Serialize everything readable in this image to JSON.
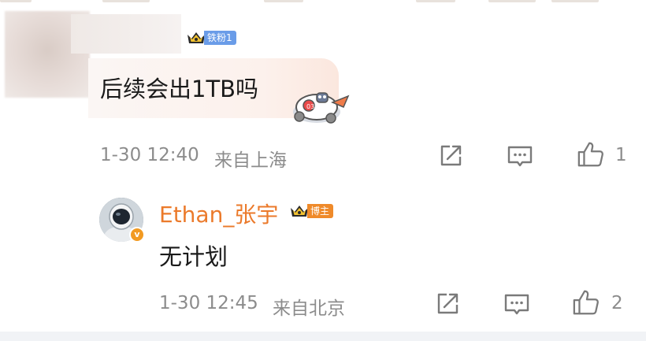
{
  "comment": {
    "badge_label": "铁粉1",
    "text": "后续会出1TB吗",
    "time": "1-30 12:40",
    "location": "来自上海",
    "like_count": "1",
    "icons": {
      "share": "share-icon",
      "reply": "comment-icon",
      "like": "thumb-up-icon"
    }
  },
  "reply": {
    "author": "Ethan_张宇",
    "badge_label": "博主",
    "text": "无计划",
    "time": "1-30 12:45",
    "location": "来自北京",
    "like_count": "2",
    "icons": {
      "share": "share-icon",
      "reply": "comment-icon",
      "like": "thumb-up-icon"
    }
  },
  "colors": {
    "author_name": "#eb7a2b",
    "fan_badge": "#6a9ce8",
    "host_badge": "#ef8a2a",
    "meta_text": "#8c8c8c"
  }
}
